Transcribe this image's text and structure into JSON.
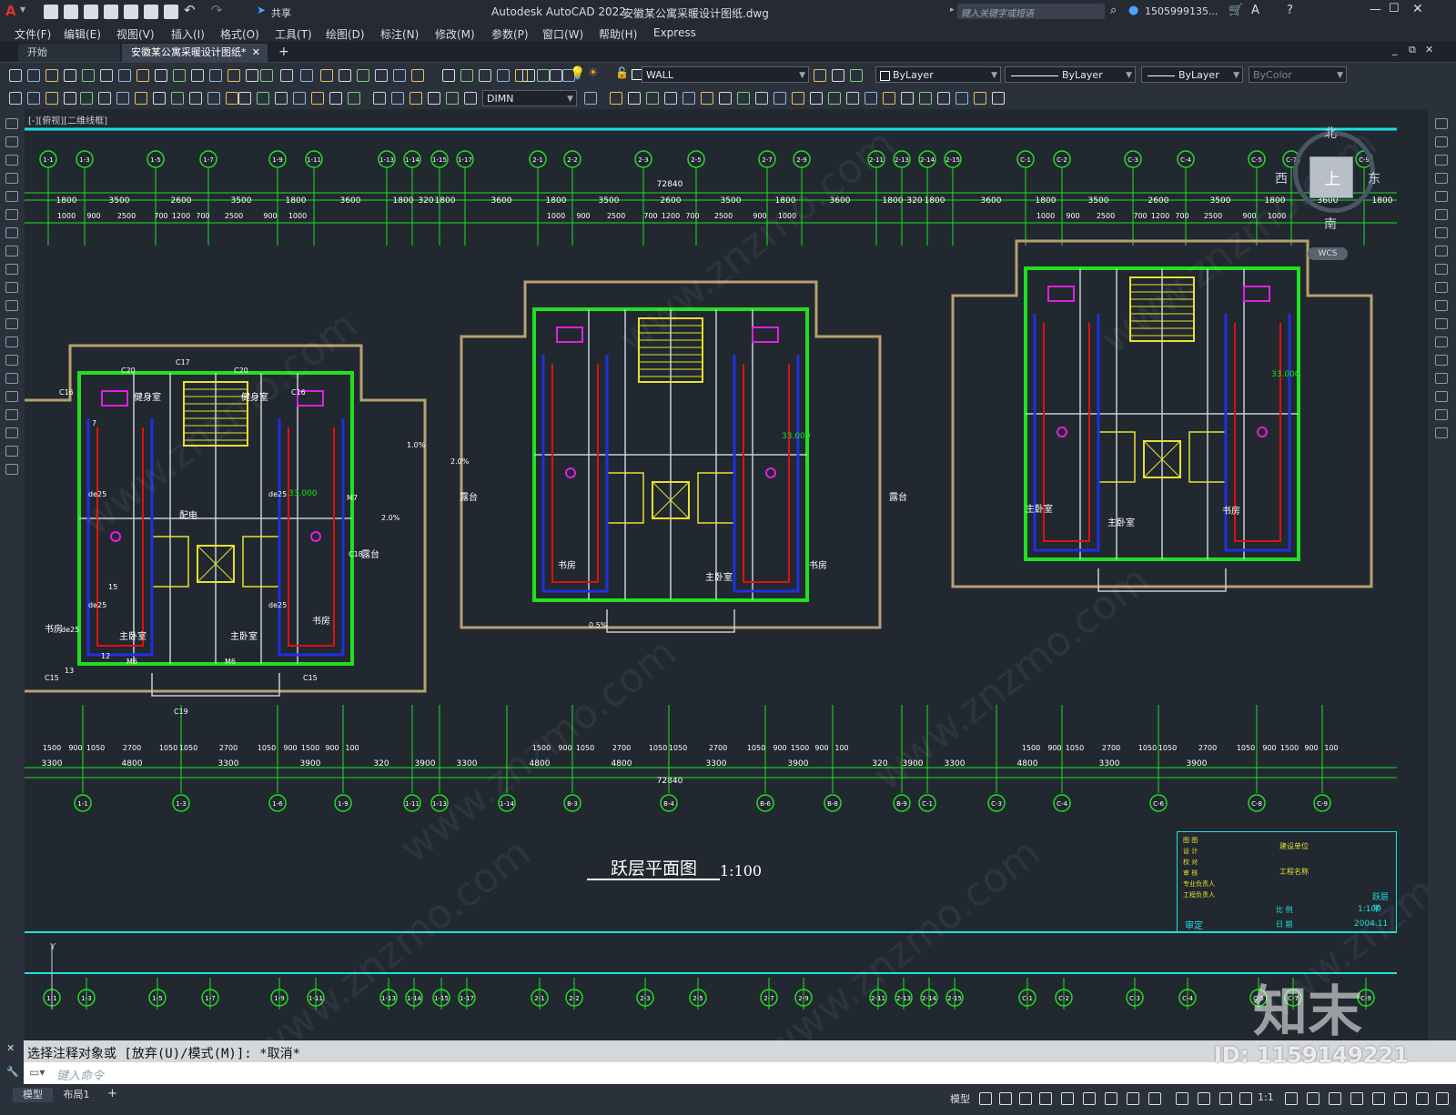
{
  "app": {
    "title": "Autodesk AutoCAD 2022",
    "document_name": "安徽某公寓采暖设计图纸.dwg",
    "share_label": "共享",
    "search_placeholder": "键入关键字或短语",
    "user": "1505999135...",
    "logo_letter": "A"
  },
  "menus": [
    "文件(F)",
    "编辑(E)",
    "视图(V)",
    "插入(I)",
    "格式(O)",
    "工具(T)",
    "绘图(D)",
    "标注(N)",
    "修改(M)",
    "参数(P)",
    "窗口(W)",
    "帮助(H)",
    "Express"
  ],
  "tabs": [
    {
      "label": "开始",
      "active": false
    },
    {
      "label": "安徽某公寓采暖设计图纸*",
      "active": true
    }
  ],
  "toolbar": {
    "layer": "WALL",
    "color": "ByLayer",
    "linetype": "ByLayer",
    "lineweight": "ByLayer",
    "plotstyle": "ByColor",
    "dimstyle": "DIMN"
  },
  "viewport_label": "[-][俯视][二维线框]",
  "viewcube": {
    "north": "北",
    "south": "南",
    "east": "东",
    "west": "西",
    "top": "上",
    "wcs": "WCS"
  },
  "drawing": {
    "title": "跃层平面图",
    "scale": "1:100",
    "overall_dim": "72840",
    "top_dims": [
      "1800",
      "3500",
      "2600",
      "3500",
      "1800",
      "3600",
      "1800",
      "320",
      "1800",
      "3600",
      "1800",
      "3500",
      "2600",
      "3500",
      "1800",
      "3600",
      "1800",
      "320",
      "1800",
      "3600",
      "1800",
      "3500",
      "2600",
      "3500",
      "1800",
      "3600",
      "1800"
    ],
    "top_sub_dims": [
      "1000",
      "900",
      "2500",
      "700",
      "1200",
      "700",
      "2500",
      "900",
      "1000"
    ],
    "bottom_dims": [
      "3300",
      "4800",
      "3300",
      "3900",
      "320",
      "3900",
      "3300",
      "4800",
      "4800",
      "3300",
      "3900",
      "320",
      "3900",
      "3300",
      "4800",
      "3300",
      "3900"
    ],
    "bottom_sub_dims": [
      "1500",
      "900",
      "1050",
      "2700",
      "1050",
      "1050",
      "2700",
      "1050",
      "900",
      "1500",
      "900",
      "100"
    ],
    "top_axes": [
      "1-1",
      "1-3",
      "1-5",
      "1-7",
      "1-9",
      "1-11",
      "1-13",
      "1-14",
      "1-15",
      "1-17",
      "2-1",
      "2-2",
      "2-3",
      "2-5",
      "2-7",
      "2-9",
      "2-11",
      "2-13",
      "2-14",
      "2-15",
      "C-1",
      "C-2",
      "C-3",
      "C-4",
      "C-5",
      "C-7",
      "C-9"
    ],
    "bottom_axes": [
      "1-1",
      "1-3",
      "1-6",
      "1-9",
      "1-11",
      "1-13",
      "1-14",
      "B-3",
      "B-4",
      "B-6",
      "B-8",
      "B-9",
      "C-1",
      "C-3",
      "C-4",
      "C-6",
      "C-8",
      "C-9"
    ],
    "rooms": [
      "健身室",
      "健身室",
      "配电",
      "书房",
      "主卧室",
      "主卧室",
      "书房",
      "露台",
      "露台",
      "主卧室",
      "书房",
      "书房",
      "露台",
      "主卧室",
      "主卧室",
      "书房"
    ],
    "elevation": "33.000",
    "windows": [
      "C20",
      "C17",
      "C20",
      "C16",
      "C16",
      "C15",
      "C15",
      "C19",
      "M6",
      "M6",
      "M7",
      "C18"
    ],
    "pipe_labels": [
      "de25",
      "de25",
      "de25",
      "de25",
      "de25",
      "15",
      "13",
      "12",
      "7"
    ],
    "slopes": [
      "2.0%",
      "2.0%",
      "1.0%",
      "0.5%"
    ]
  },
  "titleblock": {
    "rows": [
      "图 图",
      "设 计",
      "校 对",
      "审 核",
      "专业负责人",
      "工程负责人"
    ],
    "right_top": "建设单位",
    "project": "工程名称",
    "drawing_name": "跃层平",
    "scale_label": "比 例",
    "scale_value": "1:100",
    "date_label": "日 期",
    "date_value": "2004.11",
    "approve": "审定"
  },
  "command": {
    "history": "选择注释对象或 [放弃(U)/模式(M)]: *取消*",
    "prompt_placeholder": "键入命令"
  },
  "status": {
    "model_tab": "模型",
    "layout_tab": "布局1",
    "add_tab": "+",
    "mode_label": "模型",
    "scale": "1:1"
  },
  "watermarks": {
    "site": "www.znzmo.com",
    "brand_cn": "知末网",
    "logo": "知末",
    "id": "ID: 1159149221"
  },
  "colors": {
    "wall_green": "#20e020",
    "pipe_red": "#e01010",
    "pipe_blue": "#2030e0",
    "cyan": "#20e0e0",
    "yellow": "#e8e030",
    "magenta": "#e020e0",
    "tan": "#b8a070"
  }
}
